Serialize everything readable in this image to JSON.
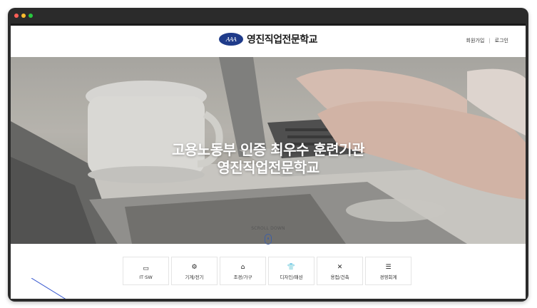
{
  "window": {
    "dot_colors": [
      "#ff5f57",
      "#febc2e",
      "#28c840"
    ]
  },
  "header": {
    "logo_mark": "AAA",
    "logo_text": "영진직업전문학교",
    "util_links": [
      "회원가입",
      "로그인"
    ],
    "util_separator": "|"
  },
  "hero": {
    "line1": "고용노동부 인증 최우수 훈련기관",
    "line2": "영진직업전문학교"
  },
  "scroll": {
    "label": "SCROLL DOWN"
  },
  "categories": [
    {
      "label": "IT·SW",
      "icon": "monitor-icon",
      "glyph": "▭"
    },
    {
      "label": "기계/전기",
      "icon": "gears-icon",
      "glyph": "⚙"
    },
    {
      "label": "조경/가구",
      "icon": "house-icon",
      "glyph": "⌂"
    },
    {
      "label": "디자인/패션",
      "icon": "shirt-icon",
      "glyph": "👕"
    },
    {
      "label": "용접/건축",
      "icon": "tools-icon",
      "glyph": "✕"
    },
    {
      "label": "경영회계",
      "icon": "list-icon",
      "glyph": "☰"
    }
  ],
  "colors": {
    "brand_blue": "#1f3b8a",
    "accent_blue": "#3f5fa3"
  }
}
